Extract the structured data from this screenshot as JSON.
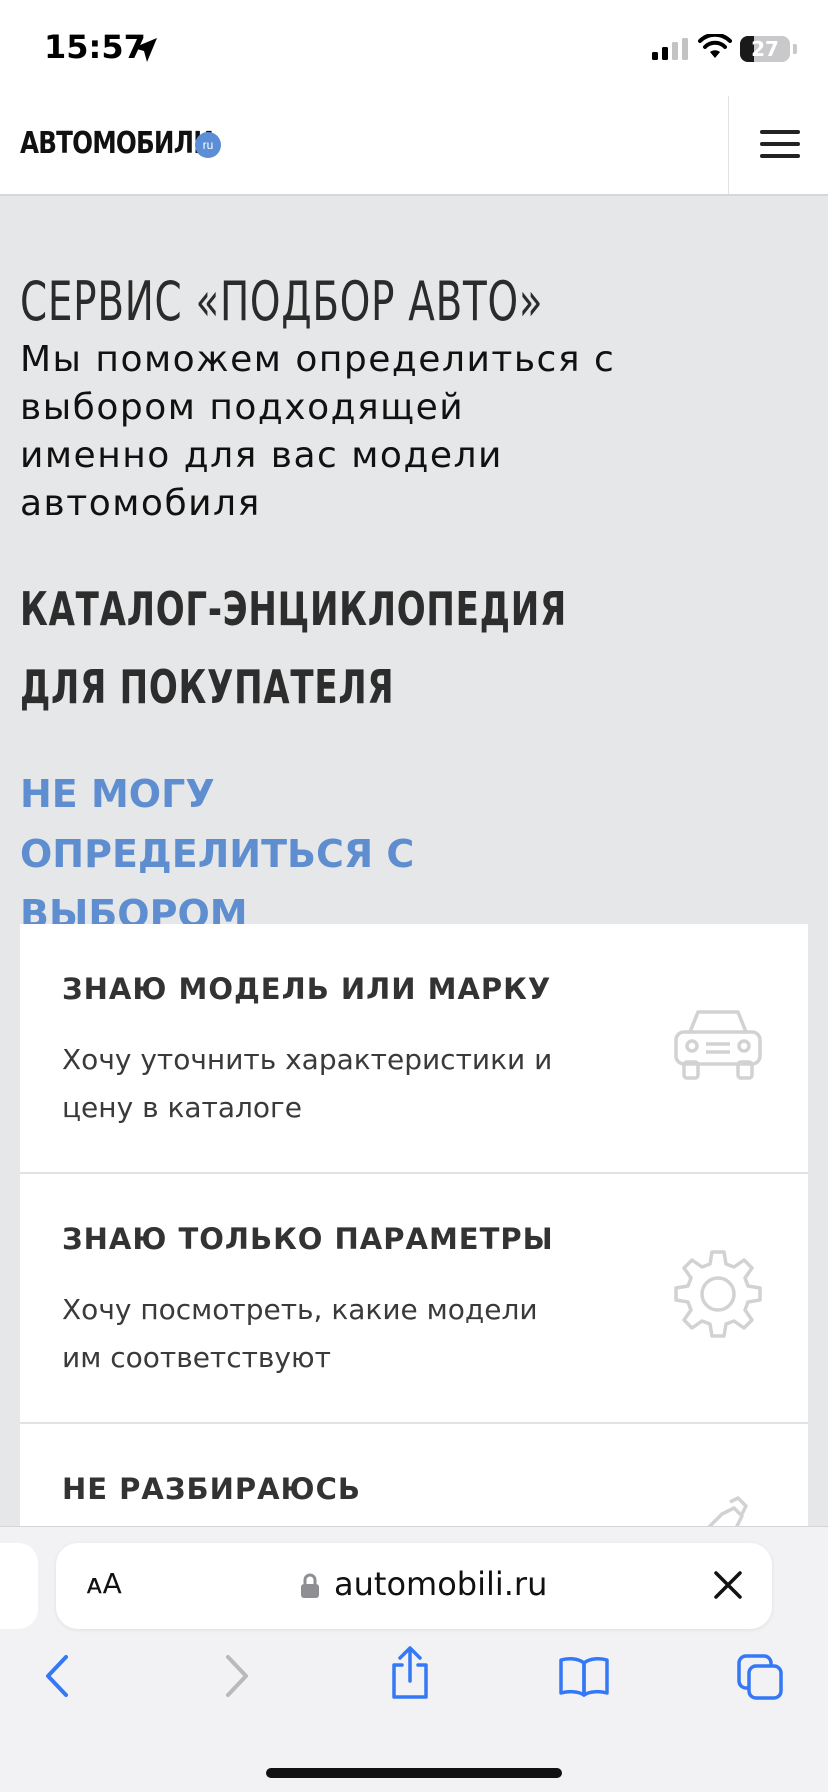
{
  "status_bar": {
    "time": "15:57",
    "battery_level": "27",
    "battery_fraction": 0.27
  },
  "header": {
    "logo_text": "АВТОМОБИЛИ",
    "logo_badge": "ru"
  },
  "main": {
    "service_title": "СЕРВИС «ПОДБОР АВТО»",
    "service_description": "Мы поможем определиться с выбором подходящей именно для вас модели автомобиля",
    "catalog_link": "КАТАЛОГ-ЭНЦИКЛОПЕДИЯ ДЛЯ ПОКУПАТЕЛЯ",
    "cant_decide_link": "НЕ МОГУ ОПРЕДЕЛИТЬСЯ С ВЫБОРОМ"
  },
  "cards": [
    {
      "title": "ЗНАЮ МОДЕЛЬ ИЛИ МАРКУ",
      "description": "Хочу уточнить характеристики и цену в каталоге",
      "icon": "car-icon"
    },
    {
      "title": "ЗНАЮ ТОЛЬКО ПАРАМЕТРЫ",
      "description": "Хочу посмотреть, какие модели им соответствуют",
      "icon": "gear-icon"
    },
    {
      "title": "НЕ РАЗБИРАЮСЬ",
      "description": "",
      "icon": "wrench-icon"
    }
  ],
  "browser": {
    "aa_label": "ᴀA",
    "url": "automobili.ru"
  },
  "colors": {
    "accent_blue": "#5e8dd0",
    "page_bg": "#e6e7e8",
    "ios_blue": "#3478f6"
  }
}
